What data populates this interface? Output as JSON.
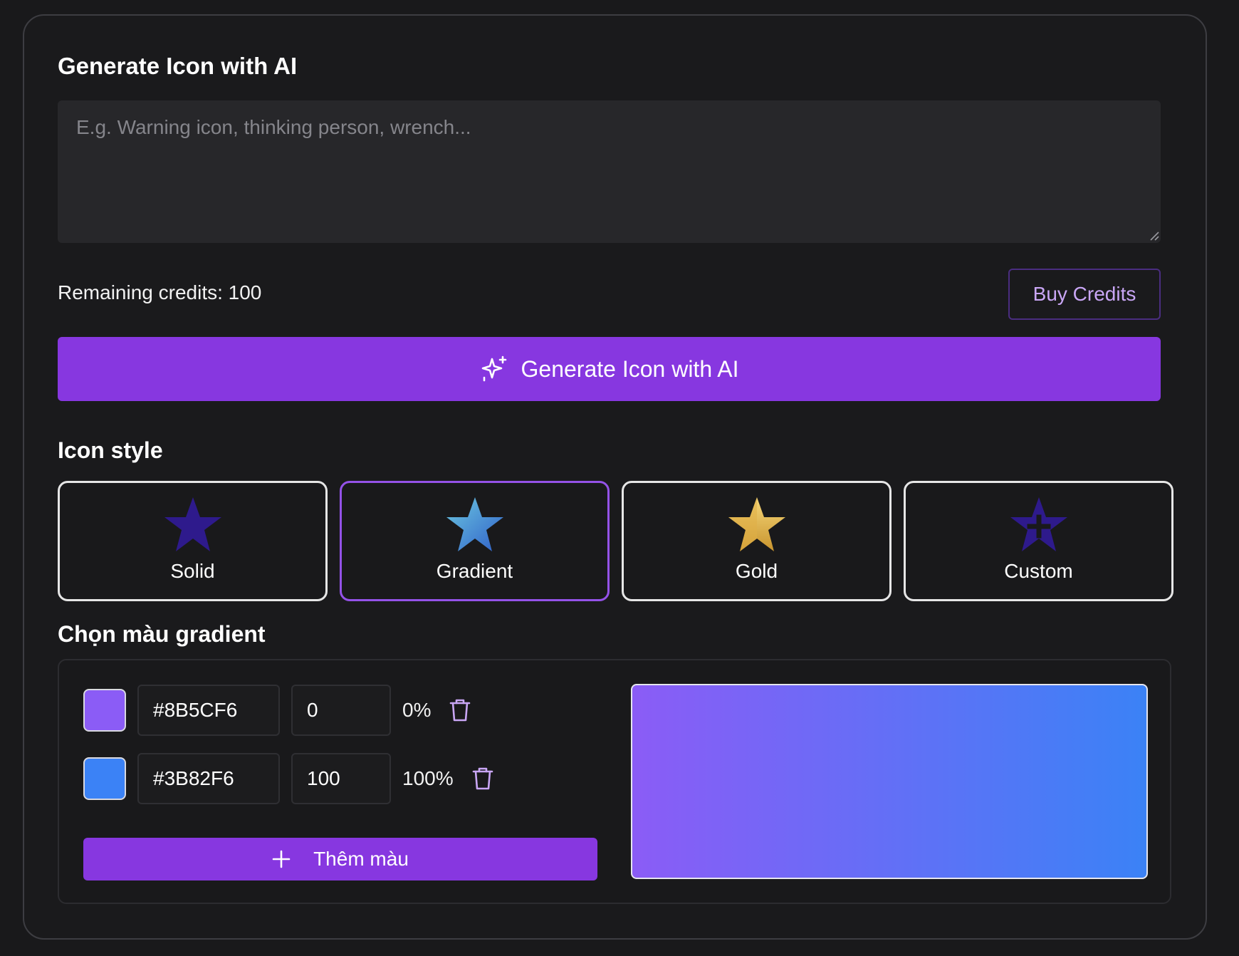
{
  "panel": {
    "title": "Generate Icon with AI"
  },
  "prompt": {
    "placeholder": "E.g. Warning icon, thinking person, wrench...",
    "value": ""
  },
  "credits": {
    "text": "Remaining credits: 100",
    "remaining": 100,
    "buy_label": "Buy Credits"
  },
  "generate": {
    "label": "Generate Icon with AI",
    "icon": "sparkles-icon"
  },
  "icon_style": {
    "heading": "Icon style",
    "selected": "Gradient",
    "options": [
      {
        "label": "Solid",
        "icon": "star-solid-icon"
      },
      {
        "label": "Gradient",
        "icon": "star-gradient-icon"
      },
      {
        "label": "Gold",
        "icon": "star-gold-icon"
      },
      {
        "label": "Custom",
        "icon": "star-custom-icon"
      }
    ]
  },
  "gradient": {
    "heading": "Chọn màu gradient",
    "stops": [
      {
        "color": "#8B5CF6",
        "hex": "#8B5CF6",
        "position": "0",
        "percent": "0%"
      },
      {
        "color": "#3B82F6",
        "hex": "#3B82F6",
        "position": "100",
        "percent": "100%"
      }
    ],
    "add_label": "Thêm màu"
  },
  "colors": {
    "accent": "#8737E0",
    "background": "#19191B",
    "input_bg": "#27272A",
    "solid_star": "#2E1A8C",
    "gold_star": "#E2B84E"
  }
}
